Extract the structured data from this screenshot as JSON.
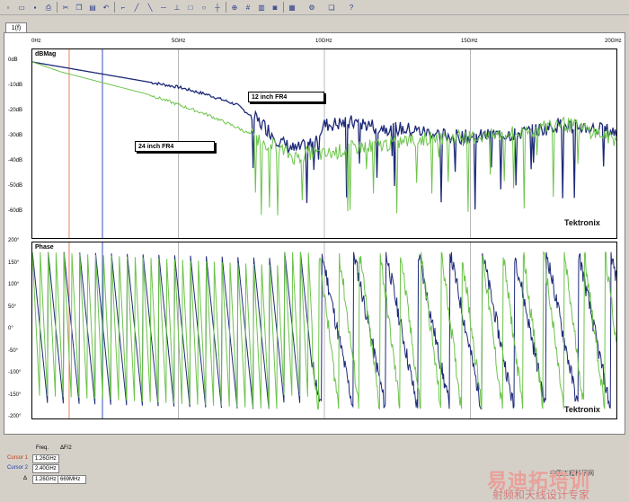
{
  "toolbar": {
    "icons": [
      "new-file-icon",
      "open-folder-icon",
      "save-icon",
      "print-icon",
      "cut-icon",
      "copy-icon",
      "paste-icon",
      "undo-icon",
      "marker-icon",
      "trace-a-icon",
      "trace-b-icon",
      "line-icon",
      "axis-icon",
      "square-icon",
      "circle-icon",
      "cursor-icon",
      "zoom-icon",
      "grid-icon",
      "chart-icon",
      "camera-icon",
      "table-icon",
      "settings-icon",
      "window-icon",
      "help-icon"
    ]
  },
  "tab": {
    "label": "1(f)"
  },
  "freq_axis": {
    "ticks": [
      "0Hz",
      "5GHz",
      "10GHz",
      "15GHz",
      "20GHz"
    ]
  },
  "mag_plot": {
    "title": "dBMag",
    "yticks": [
      "0dB",
      "-10dB",
      "-20dB",
      "-30dB",
      "-40dB",
      "-50dB",
      "-60dB"
    ],
    "brand": "Tektronix",
    "callout_12": "12 inch FR4",
    "callout_24": "24 inch FR4"
  },
  "phase_plot": {
    "title": "Phase",
    "yticks": [
      "200°",
      "150°",
      "100°",
      "50°",
      "0°",
      "-50°",
      "-100°",
      "-150°",
      "-200°"
    ],
    "brand": "Tektronix"
  },
  "colors": {
    "trace_12": "#1e2a78",
    "trace_24": "#6cc44a",
    "cursor1": "#e88060",
    "cursor2": "#3050c0"
  },
  "chart_data": [
    {
      "type": "line",
      "title": "dBMag",
      "x_unit": "GHz",
      "xlim": [
        0,
        20
      ],
      "ylim": [
        -70,
        5
      ],
      "series": [
        {
          "name": "12 inch FR4",
          "x": [
            0,
            1,
            2,
            3,
            4,
            5,
            6,
            7,
            8,
            8.5,
            9,
            9.5,
            10,
            11,
            12,
            13,
            14,
            15,
            16,
            17,
            18,
            19,
            20
          ],
          "values": [
            0,
            -2,
            -4,
            -6,
            -8,
            -10,
            -13,
            -17,
            -26,
            -32,
            -35,
            -33,
            -25,
            -24,
            -26,
            -27,
            -29,
            -30,
            -29,
            -28,
            -25,
            -26,
            -28
          ]
        },
        {
          "name": "24 inch FR4",
          "x": [
            0,
            1,
            2,
            3,
            4,
            5,
            6,
            7,
            8,
            8.5,
            9,
            9.5,
            10,
            11,
            12,
            13,
            14,
            15,
            16,
            17,
            18,
            19,
            20
          ],
          "values": [
            0,
            -4,
            -7,
            -10,
            -13,
            -17,
            -21,
            -26,
            -32,
            -35,
            -38,
            -36,
            -37,
            -34,
            -33,
            -31,
            -30,
            -30,
            -29,
            -28,
            -24,
            -27,
            -31
          ]
        }
      ]
    },
    {
      "type": "line",
      "title": "Phase",
      "x_unit": "GHz",
      "xlim": [
        0,
        20
      ],
      "ylim": [
        -200,
        200
      ],
      "series": [
        {
          "name": "12 inch FR4",
          "wrap_period_ghz": 0.54,
          "range": [
            -180,
            180
          ]
        },
        {
          "name": "24 inch FR4",
          "wrap_period_ghz": 0.27,
          "range": [
            -180,
            180
          ]
        }
      ]
    }
  ],
  "cursors": {
    "head_freq": "Freq.",
    "head_df": "ΔF/2",
    "c1_label": "Cursor 1",
    "c1_value": "1.26GHz",
    "c2_label": "Cursor 2",
    "c2_value": "2.40GHz",
    "delta_label": "Δ",
    "delta_value": "1.26GHz",
    "delta_half": "669MHz"
  },
  "watermark": {
    "line1": "易迪拓培训",
    "line2": "射频和天线设计专家",
    "line3": "中国工程科研网"
  }
}
